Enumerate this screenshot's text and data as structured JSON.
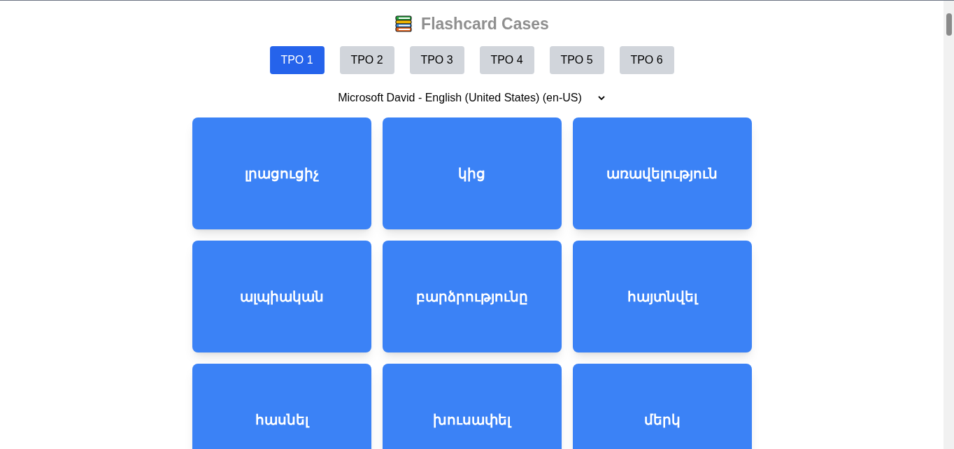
{
  "header": {
    "title": "Flashcard Cases"
  },
  "tabs": [
    {
      "label": "TPO 1",
      "selected": true
    },
    {
      "label": "TPO 2",
      "selected": false
    },
    {
      "label": "TPO 3",
      "selected": false
    },
    {
      "label": "TPO 4",
      "selected": false
    },
    {
      "label": "TPO 5",
      "selected": false
    },
    {
      "label": "TPO 6",
      "selected": false
    }
  ],
  "voice_select": {
    "value": "Microsoft David - English (United States) (en-US)"
  },
  "cards": [
    {
      "word": "լրացուցիչ"
    },
    {
      "word": "կից"
    },
    {
      "word": "առավելություն"
    },
    {
      "word": "ալպիական"
    },
    {
      "word": "բարձրությունը"
    },
    {
      "word": "հայտնվել"
    },
    {
      "word": "հասնել"
    },
    {
      "word": "խուսափել"
    },
    {
      "word": "մերկ"
    }
  ]
}
